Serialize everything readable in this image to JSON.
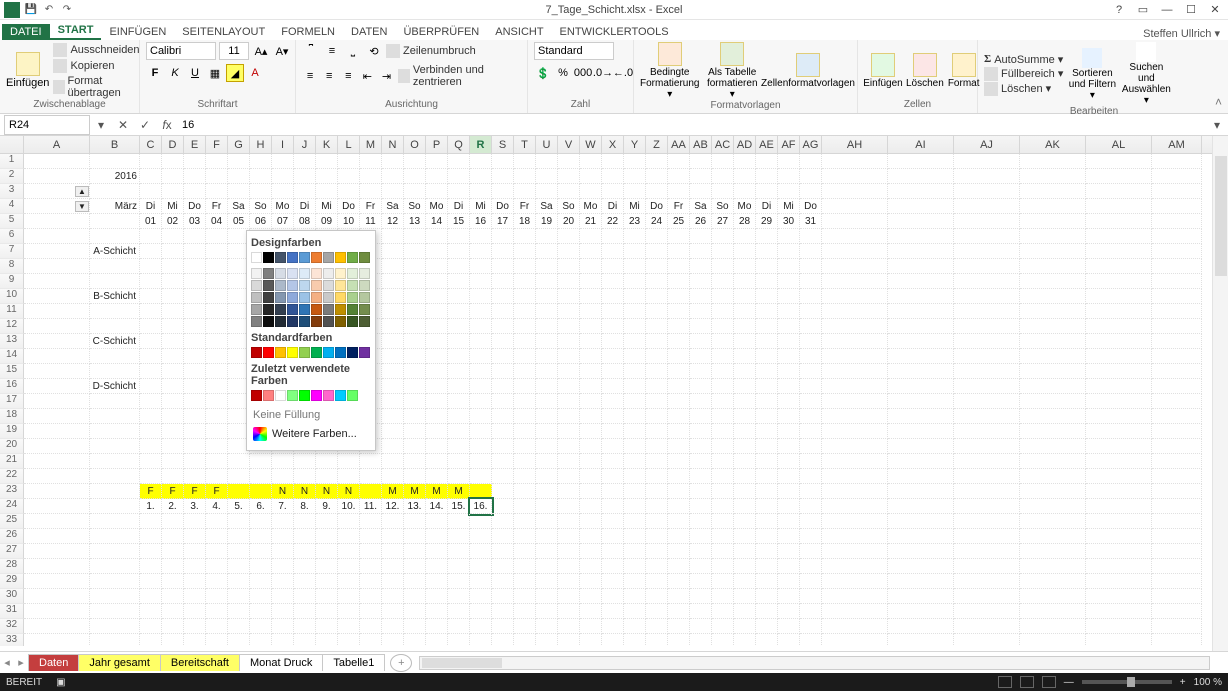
{
  "title": "7_Tage_Schicht.xlsx - Excel",
  "user": "Steffen Ullrich ▾",
  "tabs": {
    "file": "DATEI",
    "items": [
      "START",
      "EINFÜGEN",
      "SEITENLAYOUT",
      "FORMELN",
      "DATEN",
      "ÜBERPRÜFEN",
      "ANSICHT",
      "ENTWICKLERTOOLS"
    ],
    "active": 0
  },
  "ribbon": {
    "clipboard": {
      "paste": "Einfügen",
      "cut": "Ausschneiden",
      "copy": "Kopieren",
      "painter": "Format übertragen",
      "label": "Zwischenablage"
    },
    "font": {
      "name": "Calibri",
      "size": "11",
      "bold": "F",
      "italic": "K",
      "underline": "U",
      "label": "Schriftart"
    },
    "align": {
      "wrap": "Zeilenumbruch",
      "merge": "Verbinden und zentrieren",
      "label": "Ausrichtung"
    },
    "number": {
      "fmt": "Standard",
      "label": "Zahl"
    },
    "styles": {
      "cond": "Bedingte Formatierung ▾",
      "table": "Als Tabelle formatieren ▾",
      "cell": "Zellenformatvorlagen",
      "label": "Formatvorlagen"
    },
    "cells": {
      "insert": "Einfügen",
      "delete": "Löschen",
      "format": "Format",
      "label": "Zellen"
    },
    "editing": {
      "sum": "AutoSumme ▾",
      "fill": "Füllbereich ▾",
      "clear": "Löschen ▾",
      "sort": "Sortieren und Filtern ▾",
      "find": "Suchen und Auswählen ▾",
      "label": "Bearbeiten"
    }
  },
  "fx": {
    "namebox": "R24",
    "formula": "16"
  },
  "columns": [
    "A",
    "B",
    "C",
    "D",
    "E",
    "F",
    "G",
    "H",
    "I",
    "J",
    "K",
    "L",
    "M",
    "N",
    "O",
    "P",
    "Q",
    "R",
    "S",
    "T",
    "U",
    "V",
    "W",
    "X",
    "Y",
    "Z",
    "AA",
    "AB",
    "AC",
    "AD",
    "AE",
    "AF",
    "AG",
    "AH",
    "AI",
    "AJ",
    "AK",
    "AL",
    "AM"
  ],
  "selected_col": "R",
  "grid": {
    "year": "2016",
    "month": "März",
    "weekdays": [
      "Di",
      "Mi",
      "Do",
      "Fr",
      "Sa",
      "So",
      "Mo",
      "Di",
      "Mi",
      "Do",
      "Fr",
      "Sa",
      "So",
      "Mo",
      "Di",
      "Mi",
      "Do",
      "Fr",
      "Sa",
      "So",
      "Mo",
      "Di",
      "Mi",
      "Do",
      "Fr",
      "Sa",
      "So",
      "Mo",
      "Di",
      "Mi",
      "Do"
    ],
    "days": [
      "01",
      "02",
      "03",
      "04",
      "05",
      "06",
      "07",
      "08",
      "09",
      "10",
      "11",
      "12",
      "13",
      "14",
      "15",
      "16",
      "17",
      "18",
      "19",
      "20",
      "21",
      "22",
      "23",
      "24",
      "25",
      "26",
      "27",
      "28",
      "29",
      "30",
      "31"
    ],
    "labels": {
      "a": "A-Schicht",
      "b": "B-Schicht",
      "c": "C-Schicht",
      "d": "D-Schicht"
    },
    "row23": [
      "F",
      "F",
      "F",
      "F",
      "",
      "",
      "N",
      "N",
      "N",
      "N",
      "",
      "M",
      "M",
      "M",
      "M"
    ],
    "row24": [
      "1.",
      "2.",
      "3.",
      "4.",
      "5.",
      "6.",
      "7.",
      "8.",
      "9.",
      "10.",
      "11.",
      "12.",
      "13.",
      "14.",
      "15.",
      "16."
    ]
  },
  "popup": {
    "design": "Designfarben",
    "standard": "Standardfarben",
    "recent": "Zuletzt verwendete Farben",
    "nofill": "Keine Füllung",
    "more": "Weitere Farben...",
    "design_row": [
      "#ffffff",
      "#000000",
      "#44546a",
      "#4472c4",
      "#5b9bd5",
      "#ed7d31",
      "#a5a5a5",
      "#ffc000",
      "#70ad47",
      "#6f8d3f"
    ],
    "design_tints": [
      [
        "#f2f2f2",
        "#7f7f7f",
        "#d6dce5",
        "#d9e1f2",
        "#ddebf7",
        "#fce4d6",
        "#ededed",
        "#fff2cc",
        "#e2efda",
        "#e6eddf"
      ],
      [
        "#d9d9d9",
        "#595959",
        "#acb9ca",
        "#b4c6e7",
        "#bdd7ee",
        "#f8cbad",
        "#dbdbdb",
        "#ffe699",
        "#c6e0b4",
        "#cddabf"
      ],
      [
        "#bfbfbf",
        "#404040",
        "#8497b0",
        "#8ea9db",
        "#9bc2e6",
        "#f4b084",
        "#c9c9c9",
        "#ffd966",
        "#a9d08e",
        "#b4c79f"
      ],
      [
        "#a6a6a6",
        "#262626",
        "#333f50",
        "#305496",
        "#2f75b5",
        "#c65911",
        "#7b7b7b",
        "#bf8f00",
        "#548235",
        "#748d4d"
      ],
      [
        "#808080",
        "#0d0d0d",
        "#222b35",
        "#203764",
        "#1f4e78",
        "#833c0c",
        "#525252",
        "#806000",
        "#375623",
        "#4d5e33"
      ]
    ],
    "standard_row": [
      "#c00000",
      "#ff0000",
      "#ffc000",
      "#ffff00",
      "#92d050",
      "#00b050",
      "#00b0f0",
      "#0070c0",
      "#002060",
      "#7030a0"
    ],
    "recent_row": [
      "#c00000",
      "#ff8080",
      "#ffffff",
      "#80ff80",
      "#00ff00",
      "#ff00ff",
      "#ff66cc",
      "#00ccff",
      "#66ff66"
    ]
  },
  "sheet_tabs": [
    "Daten",
    "Jahr gesamt",
    "Bereitschaft",
    "Monat Druck",
    "Tabelle1"
  ],
  "status": {
    "ready": "BEREIT",
    "zoom": "100 %"
  }
}
